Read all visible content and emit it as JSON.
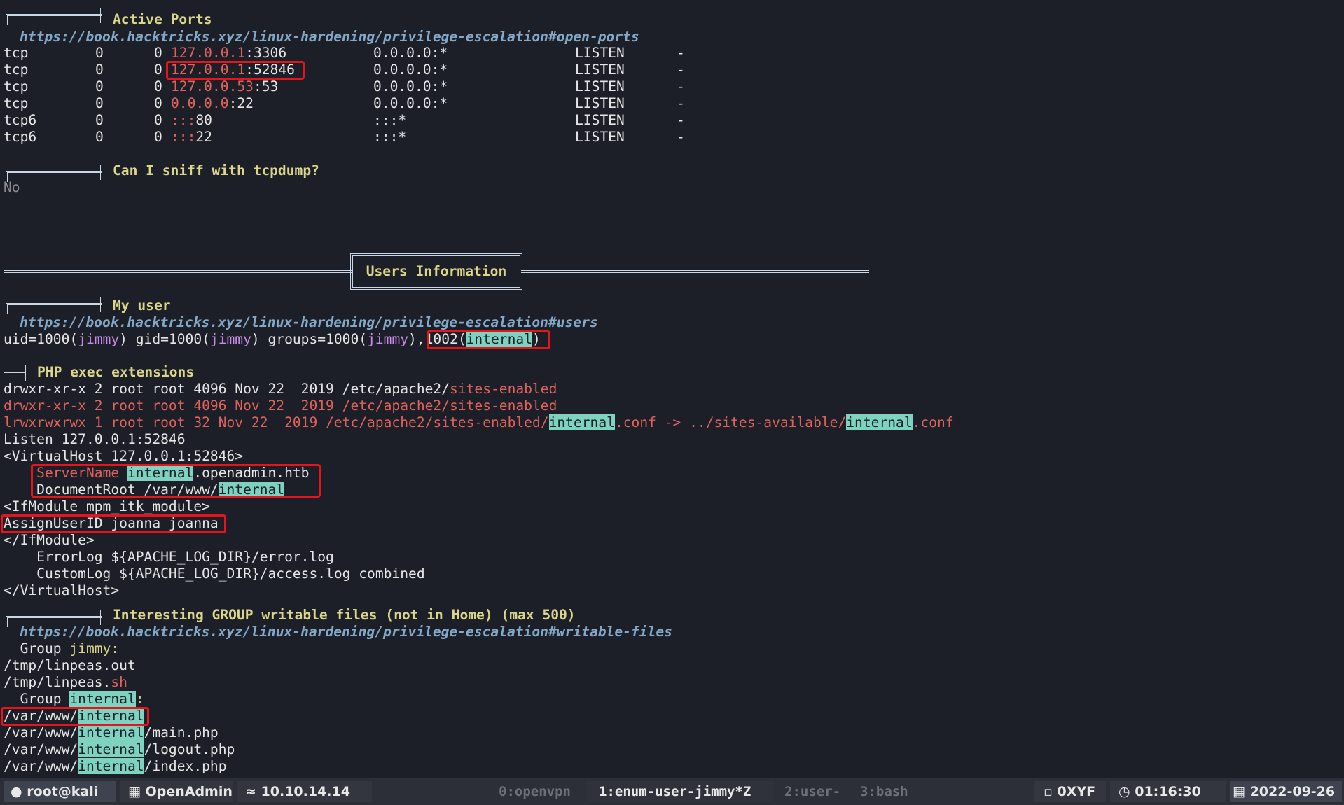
{
  "sections": {
    "active_ports_title": "Active Ports",
    "active_ports_url": "https://book.hacktricks.xyz/linux-hardening/privilege-escalation#open-ports",
    "sniff_title": "Can I sniff with tcpdump?",
    "sniff_answer": "No",
    "users_info_title": "Users Information",
    "my_user_title": "My user",
    "my_user_url": "https://book.hacktricks.xyz/linux-hardening/privilege-escalation#users",
    "php_title": "PHP exec extensions",
    "group_files_title": "Interesting GROUP writable files (not in Home) (max 500)",
    "group_files_url": "https://book.hacktricks.xyz/linux-hardening/privilege-escalation#writable-files"
  },
  "ports": [
    {
      "proto": "tcp",
      "recv": "0",
      "send": "0",
      "ip": "127.0.0.1",
      "port": ":3306",
      "foreign": "0.0.0.0:*",
      "state": "LISTEN",
      "pid": "-"
    },
    {
      "proto": "tcp",
      "recv": "0",
      "send": "0",
      "ip": "127.0.0.1",
      "port": ":52846",
      "foreign": "0.0.0.0:*",
      "state": "LISTEN",
      "pid": "-"
    },
    {
      "proto": "tcp",
      "recv": "0",
      "send": "0",
      "ip": "127.0.0.53",
      "port": ":53",
      "foreign": "0.0.0.0:*",
      "state": "LISTEN",
      "pid": "-"
    },
    {
      "proto": "tcp",
      "recv": "0",
      "send": "0",
      "ip": "0.0.0.0",
      "port": ":22",
      "foreign": "0.0.0.0:*",
      "state": "LISTEN",
      "pid": "-"
    },
    {
      "proto": "tcp6",
      "recv": "0",
      "send": "0",
      "ip": ":::",
      "port": "80",
      "foreign": ":::*",
      "state": "LISTEN",
      "pid": "-"
    },
    {
      "proto": "tcp6",
      "recv": "0",
      "send": "0",
      "ip": ":::",
      "port": "22",
      "foreign": ":::*",
      "state": "LISTEN",
      "pid": "-"
    }
  ],
  "uid_line": {
    "p1": "uid=1000(",
    "u1": "jimmy",
    "p2": ") gid=1000(",
    "u2": "jimmy",
    "p3": ") groups=1000(",
    "u3": "jimmy",
    "p4": "),",
    "p5": "1002(",
    "grp": "internal",
    "p6": ")"
  },
  "php": {
    "l1a": "drwxr-xr-x 2 root root 4096 Nov 22  2019 /etc/apache2/",
    "l1b": "sites-enabled",
    "l2": "drwxr-xr-x 2 root root 4096 Nov 22  2019 /etc/apache2/sites-enabled",
    "l3a": "lrwxrwxrwx 1 root root 32 Nov 22  2019 /etc/apache2/sites-enabled/",
    "l3b": "internal",
    "l3c": ".conf -> ../sites-available/",
    "l3d": "internal",
    "l3e": ".conf",
    "l4": "Listen 127.0.0.1:52846",
    "l5": "<VirtualHost 127.0.0.1:52846>",
    "l6a": "    ServerName ",
    "l6b": "internal",
    "l6c": ".openadmin.htb",
    "l7a": "    DocumentRoot /var/www/",
    "l7b": "internal",
    "l8": "<IfModule mpm_itk_module>",
    "l9": "AssignUserID joanna joanna",
    "l10": "</IfModule>",
    "l11": "    ErrorLog ${APACHE_LOG_DIR}/error.log",
    "l12": "    CustomLog ${APACHE_LOG_DIR}/access.log combined",
    "l13": "</VirtualHost>"
  },
  "group_files": {
    "g1a": "  Group ",
    "g1b": "jimmy:",
    "f1": "/tmp/linpeas.out",
    "f2a": "/tmp/linpeas.",
    "f2b": "sh",
    "g2a": "  Group ",
    "g2b": "internal",
    "g2c": ":",
    "prefix": "/var/www/",
    "internal": "internal",
    "s1": "/main.php",
    "s2": "/logout.php",
    "s3": "/index.php"
  },
  "statusbar": {
    "user": "root@kali",
    "session": "OpenAdmin",
    "ip": "10.10.14.14",
    "windows": [
      "0:openvpn",
      "1:enum-user-jimmy*Z",
      "2:user-",
      "3:bash"
    ],
    "host": "0XYF",
    "time": "01:16:30",
    "date": "2022-09-26"
  }
}
